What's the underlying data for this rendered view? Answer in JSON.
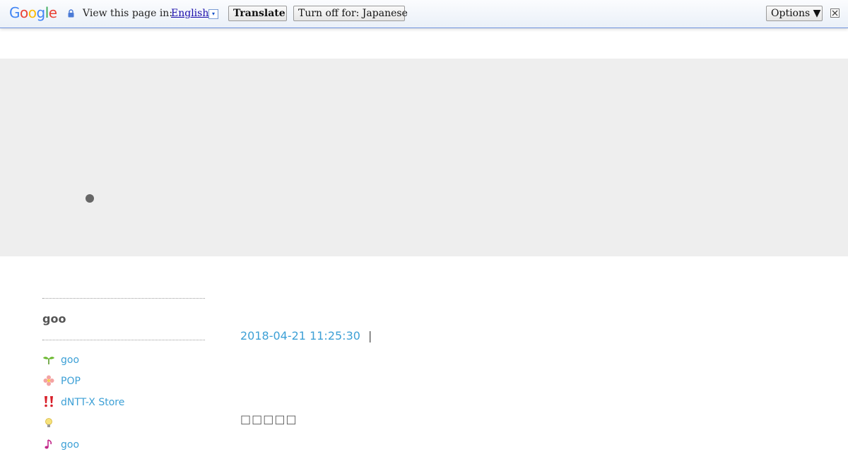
{
  "translate_bar": {
    "logo_letters": [
      {
        "char": "G",
        "color": "#4285f4"
      },
      {
        "char": "o",
        "color": "#ea4335"
      },
      {
        "char": "o",
        "color": "#fbbc05"
      },
      {
        "char": "g",
        "color": "#4285f4"
      },
      {
        "char": "l",
        "color": "#34a853"
      },
      {
        "char": "e",
        "color": "#ea4335"
      }
    ],
    "view_label": "View this page in:",
    "language": "English",
    "language_arrow": "▾",
    "translate_button": "Translate",
    "turn_off_button": "Turn off for: Japanese",
    "options_button": "Options ▼",
    "lock_icon": "lock-icon",
    "close_icon": "close-icon"
  },
  "sidebar": {
    "title": "goo",
    "items": [
      {
        "icon": "sprout-icon",
        "glyph": "🌱",
        "color": "#4a9e2a",
        "label": "goo"
      },
      {
        "icon": "flower-icon",
        "glyph": "✿",
        "color": "#f08a8a",
        "label": "POP"
      },
      {
        "icon": "double-exclamation-icon",
        "glyph": "‼",
        "color": "#d8202a",
        "label": "dNTT-X Store"
      },
      {
        "icon": "lightbulb-icon",
        "glyph": "●",
        "color": "#e8c33a",
        "label": ""
      },
      {
        "icon": "music-note-icon",
        "glyph": "♪",
        "color": "#c2278a",
        "label": "goo"
      }
    ]
  },
  "entry": {
    "date": "2018-04-21 11:25:30",
    "separator": "|",
    "text": "□□□□□"
  },
  "colors": {
    "link": "#3da0d6",
    "banner": "#eeeeee",
    "bar_border": "#6b90da"
  }
}
